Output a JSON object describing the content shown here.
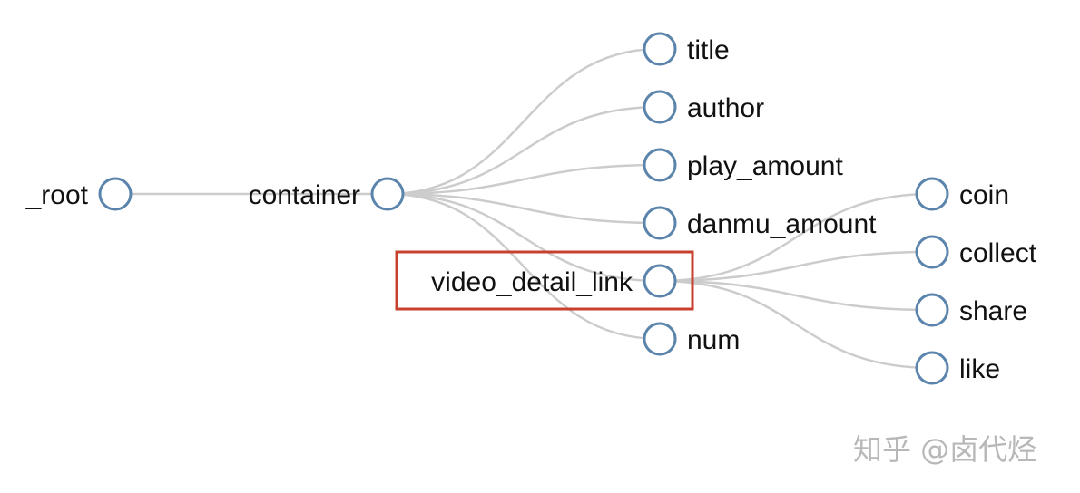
{
  "diagram": {
    "type": "tree",
    "nodes": [
      {
        "id": "_root",
        "label": "_root",
        "parent": null,
        "label_side": "left"
      },
      {
        "id": "container",
        "label": "container",
        "parent": "_root",
        "label_side": "left"
      },
      {
        "id": "title",
        "label": "title",
        "parent": "container",
        "label_side": "right"
      },
      {
        "id": "author",
        "label": "author",
        "parent": "container",
        "label_side": "right"
      },
      {
        "id": "play_amount",
        "label": "play_amount",
        "parent": "container",
        "label_side": "right"
      },
      {
        "id": "danmu_amount",
        "label": "danmu_amount",
        "parent": "container",
        "label_side": "right"
      },
      {
        "id": "video_detail_link",
        "label": "video_detail_link",
        "parent": "container",
        "label_side": "left",
        "highlighted": true
      },
      {
        "id": "num",
        "label": "num",
        "parent": "container",
        "label_side": "right"
      },
      {
        "id": "coin",
        "label": "coin",
        "parent": "video_detail_link",
        "label_side": "right"
      },
      {
        "id": "collect",
        "label": "collect",
        "parent": "video_detail_link",
        "label_side": "right"
      },
      {
        "id": "share",
        "label": "share",
        "parent": "video_detail_link",
        "label_side": "right"
      },
      {
        "id": "like",
        "label": "like",
        "parent": "video_detail_link",
        "label_side": "right"
      }
    ],
    "colors": {
      "node_stroke": "#5b84ad",
      "link": "#cccccc",
      "highlight": "#c8402e"
    }
  },
  "watermark": "知乎 @卤代烃"
}
